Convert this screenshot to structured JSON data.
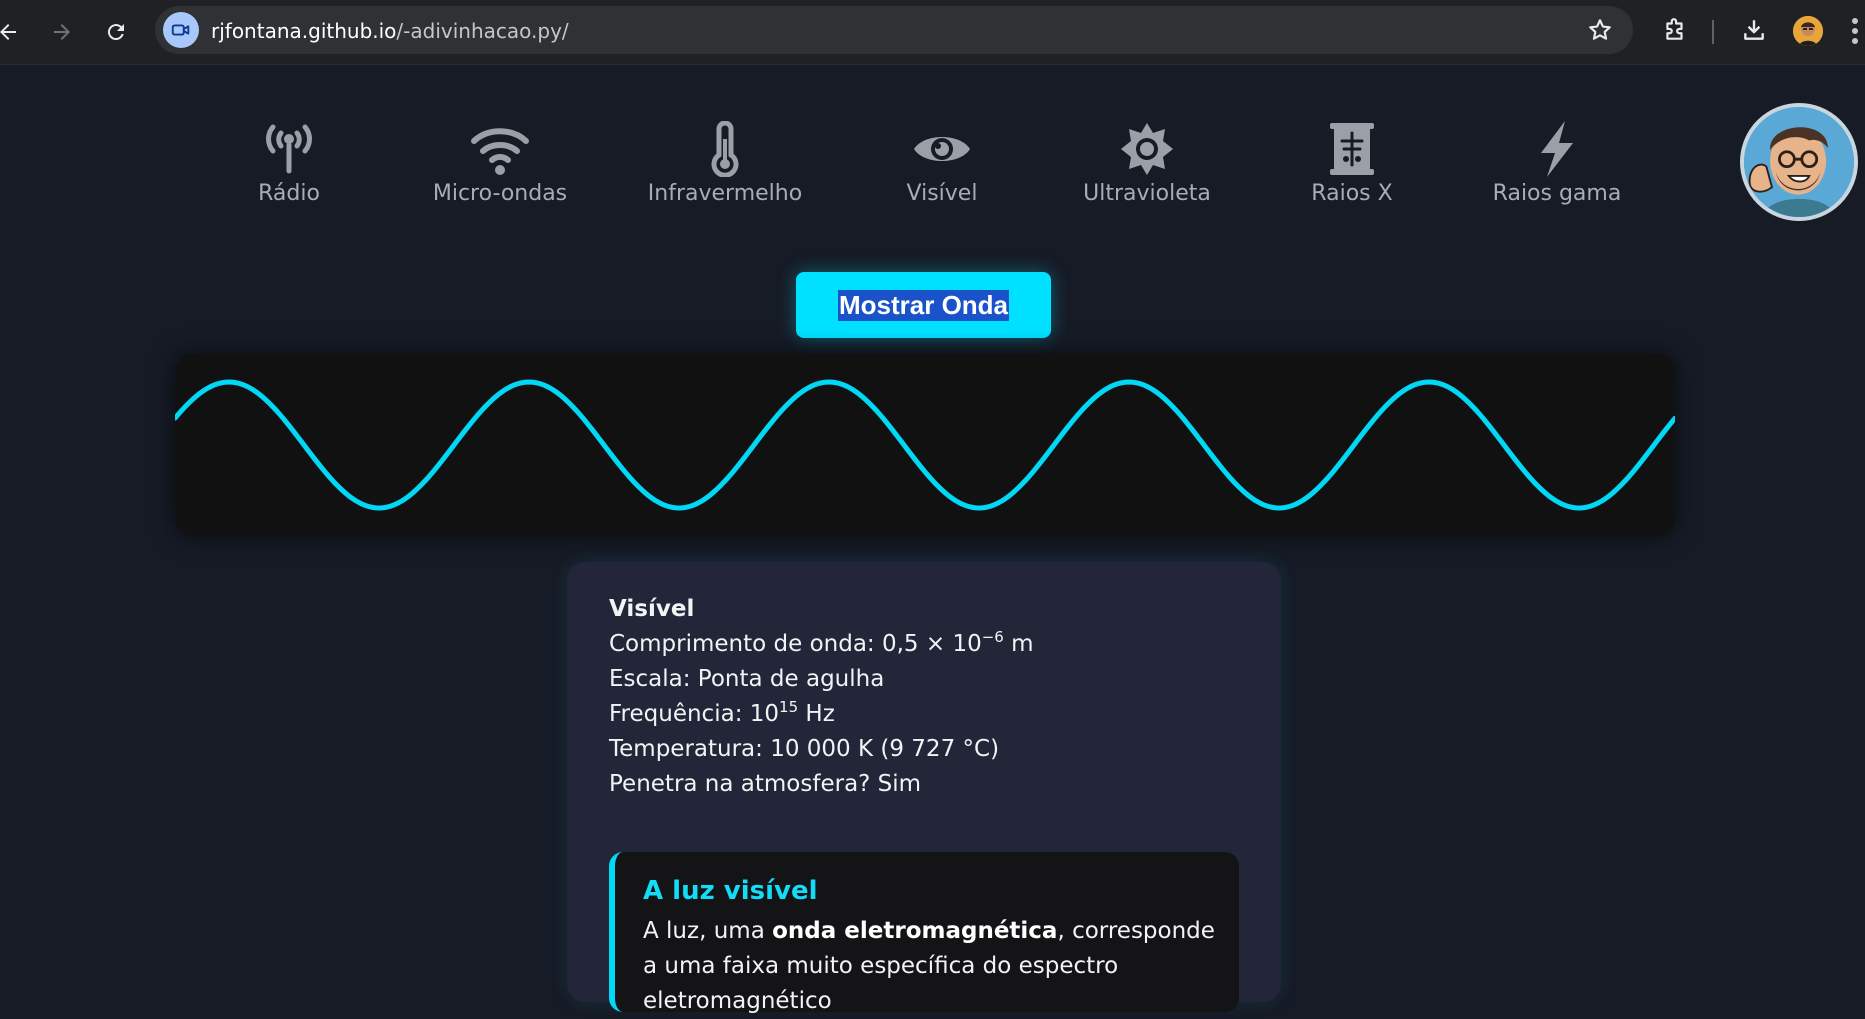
{
  "browser": {
    "url_host": "rjfontana.github.io",
    "url_path": "/-adivinhacao.py/"
  },
  "bands": [
    {
      "label": "Rádio",
      "icon": "radio-tower-icon"
    },
    {
      "label": "Micro-ondas",
      "icon": "wifi-icon"
    },
    {
      "label": "Infravermelho",
      "icon": "thermometer-icon"
    },
    {
      "label": "Visível",
      "icon": "eye-icon"
    },
    {
      "label": "Ultravioleta",
      "icon": "sun-icon"
    },
    {
      "label": "Raios X",
      "icon": "x-ray-icon"
    },
    {
      "label": "Raios gama",
      "icon": "lightning-icon"
    }
  ],
  "show_wave_button": "Mostrar Onda",
  "wave": {
    "cycles": 5,
    "color": "#00d8f5"
  },
  "info": {
    "title": "Visível",
    "wavelength_prefix": "Comprimento de onda: 0,5 × 10",
    "wavelength_exp": "−6",
    "wavelength_unit": " m",
    "scale": "Escala: Ponta de agulha",
    "frequency_prefix": "Frequência: 10",
    "frequency_exp": "15",
    "frequency_unit": " Hz",
    "temperature": "Temperatura: 10 000 K (9 727 °C)",
    "atmosphere": "Penetra na atmosfera? Sim"
  },
  "note": {
    "title": "A luz visível",
    "text_start": "A luz, uma ",
    "text_bold": "onda eletromagnética",
    "text_end": ", corresponde a uma faixa muito específica do espectro eletromagnético"
  },
  "colors": {
    "accent": "#00e1ff",
    "background": "#161b26",
    "card": "#232639"
  }
}
